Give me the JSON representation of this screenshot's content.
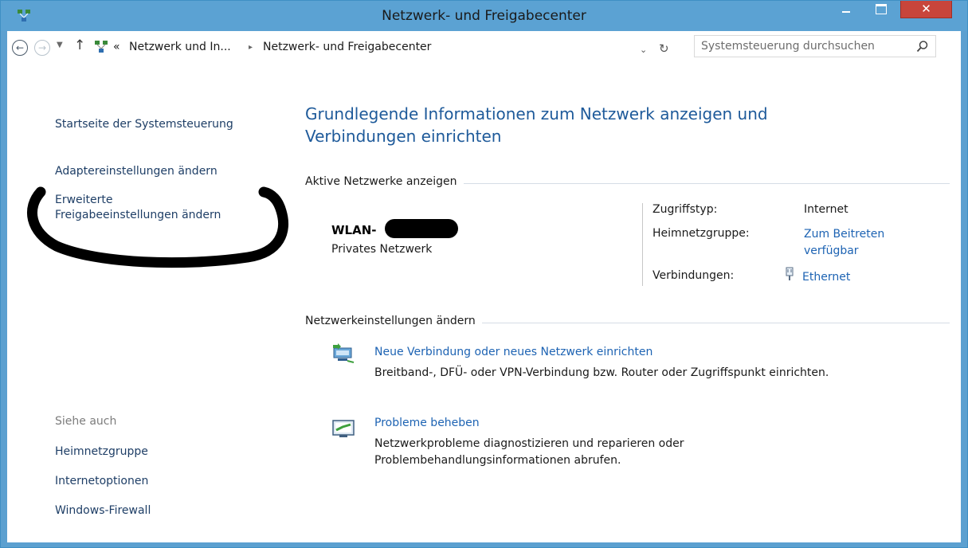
{
  "window": {
    "title": "Netzwerk- und Freigabecenter",
    "close_glyph": "✕"
  },
  "nav": {
    "path_prefix": "«",
    "breadcrumb": [
      "Netzwerk und In...",
      "Netzwerk- und Freigabecenter"
    ],
    "separator": "▸",
    "search_placeholder": "Systemsteuerung durchsuchen"
  },
  "sidebar": {
    "links": [
      "Startseite der Systemsteuerung",
      "Adaptereinstellungen ändern",
      "Erweiterte",
      "Freigabeeinstellungen ändern"
    ],
    "see_also_label": "Siehe auch",
    "see_also": [
      "Heimnetzgruppe",
      "Internetoptionen",
      "Windows-Firewall"
    ]
  },
  "main": {
    "heading_line1": "Grundlegende Informationen zum Netzwerk anzeigen und",
    "heading_line2": "Verbindungen einrichten",
    "active_label": "Aktive Netzwerke anzeigen",
    "network": {
      "name": "WLAN-",
      "type": "Privates Netzwerk",
      "access_key": "Zugriffstyp:",
      "access_val": "Internet",
      "homegroup_key": "Heimnetzgruppe:",
      "homegroup_val1": "Zum Beitreten",
      "homegroup_val2": "verfügbar",
      "connections_key": "Verbindungen:",
      "connections_val": "Ethernet"
    },
    "change_label": "Netzwerkeinstellungen ändern",
    "tasks": [
      {
        "link": "Neue Verbindung oder neues Netzwerk einrichten",
        "desc1": "Breitband-, DFÜ- oder VPN-Verbindung bzw. Router oder Zugriffspunkt einrichten.",
        "desc2": ""
      },
      {
        "link": "Probleme beheben",
        "desc1": "Netzwerkprobleme diagnostizieren und reparieren oder",
        "desc2": "Problembehandlungsinformationen abrufen."
      }
    ]
  },
  "icons": {
    "app": "network-center-icon",
    "back": "back-arrow-icon",
    "forward": "forward-arrow-icon",
    "up": "up-arrow-icon",
    "search": "search-icon",
    "ethernet": "ethernet-plug-icon"
  }
}
